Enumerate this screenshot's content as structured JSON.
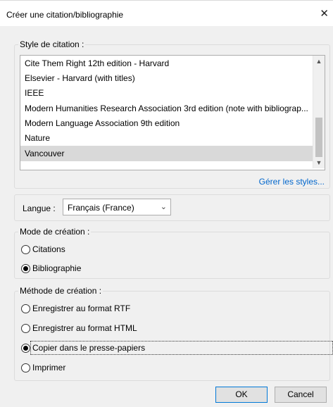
{
  "window": {
    "title": "Créer une citation/bibliographie",
    "close_glyph": "✕"
  },
  "style_section": {
    "legend": "Style de citation :",
    "items": [
      "Cite Them Right 12th edition - Harvard",
      "Elsevier - Harvard (with titles)",
      "IEEE",
      "Modern Humanities Research Association 3rd edition (note with bibliograp...",
      "Modern Language Association 9th edition",
      "Nature",
      "Vancouver"
    ],
    "selected_index": 6,
    "manage_link": "Gérer les styles..."
  },
  "language": {
    "label": "Langue :",
    "value": "Français (France)"
  },
  "mode_section": {
    "legend": "Mode de création :",
    "options": [
      "Citations",
      "Bibliographie"
    ],
    "selected_index": 1
  },
  "method_section": {
    "legend": "Méthode de création :",
    "options": [
      "Enregistrer au format RTF",
      "Enregistrer au format HTML",
      "Copier dans le presse-papiers",
      "Imprimer"
    ],
    "selected_index": 2
  },
  "buttons": {
    "ok": "OK",
    "cancel": "Cancel"
  },
  "colors": {
    "link": "#0066cc",
    "selection": "#d9d9d9",
    "default_button_border": "#0078d7"
  }
}
